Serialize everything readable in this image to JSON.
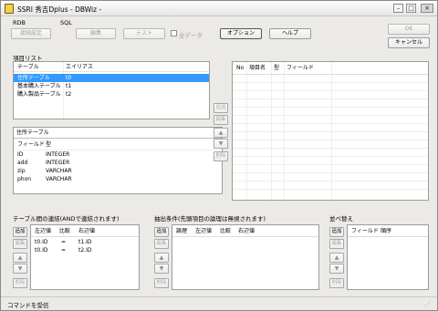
{
  "window": {
    "title": "SSRI 秀吉Dplus - DBWiz -",
    "minimize": "–",
    "maximize": "□",
    "close": "×"
  },
  "toolbar": {
    "rdb_label": "RDB",
    "rdb_settings": "接続設定",
    "sql_label": "SQL",
    "edit": "編集",
    "test": "テスト",
    "all_data": "全データ",
    "option": "オプション",
    "help": "ヘルプ",
    "ok": "OK",
    "cancel": "キャンセル"
  },
  "item_list": {
    "label": "項目リスト",
    "table_list": {
      "headers": [
        "テーブル",
        "エイリアス"
      ],
      "rows": [
        {
          "table": "住所テーブル",
          "alias": "t0",
          "selected": true
        },
        {
          "table": "基本購入テーブル",
          "alias": "t1",
          "selected": false
        },
        {
          "table": "購入製品テーブル",
          "alias": "t2",
          "selected": false
        }
      ]
    },
    "field_table": {
      "title": "住所テーブル",
      "alias": "t0",
      "headers": [
        "フィールド",
        "型"
      ],
      "rows": [
        {
          "field": "ID",
          "type": "INTEGER"
        },
        {
          "field": "add",
          "type": "INTEGER"
        },
        {
          "field": "zip",
          "type": "VARCHAR"
        },
        {
          "field": "phon",
          "type": "VARCHAR"
        }
      ]
    },
    "buttons": {
      "add": "追加",
      "edit": "編集",
      "up": "▲",
      "down": "▼",
      "delete": "削除"
    },
    "right_list": {
      "headers": [
        "No",
        "項目名",
        "型",
        "フィールド"
      ]
    }
  },
  "join": {
    "label": "テーブル間の連結(ANDで連結されます)",
    "headers": [
      "左辺値",
      "比較",
      "右辺値"
    ],
    "rows": [
      {
        "left": "t0.ID",
        "op": "=",
        "right": "t1.ID"
      },
      {
        "left": "t0.ID",
        "op": "=",
        "right": "t2.ID"
      }
    ],
    "buttons": {
      "add": "追加",
      "edit": "編集",
      "up": "▲",
      "down": "▼",
      "delete": "削除"
    }
  },
  "filter": {
    "label": "抽出条件(先頭項目の論理は無視されます)",
    "headers": [
      "論理",
      "左辺値",
      "比較",
      "右辺値"
    ],
    "buttons": {
      "add": "追加",
      "edit": "編集",
      "up": "▲",
      "down": "▼",
      "delete": "削除"
    }
  },
  "sort": {
    "label": "並べ替え",
    "headers": [
      "フィールド",
      "順序"
    ],
    "buttons": {
      "add": "追加",
      "edit": "編集",
      "up": "▲",
      "down": "▼",
      "delete": "削除"
    }
  },
  "status": {
    "text": "コマンドを受信",
    "grip": "⋰"
  }
}
